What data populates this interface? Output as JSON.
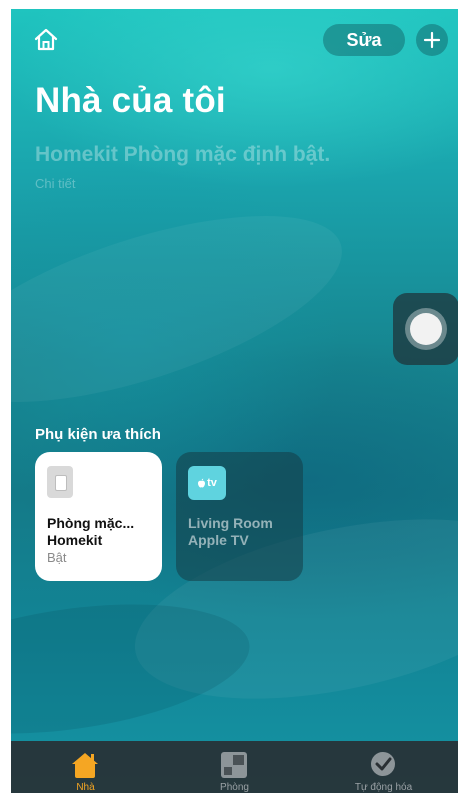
{
  "header": {
    "edit_label": "Sửa",
    "add_icon": "plus-icon",
    "home_icon": "house-outline-icon"
  },
  "home": {
    "title": "Nhà của tôi",
    "status_summary": "Homekit Phòng mặc định bật.",
    "details_link": "Chi tiết"
  },
  "favorites": {
    "section_title": "Phụ kiện ưa thích",
    "tiles": [
      {
        "name_line1": "Phòng mặc...",
        "name_line2": "Homekit",
        "status": "Bật",
        "icon": "light-switch-icon",
        "active": true
      },
      {
        "name_line1": "Living Room",
        "name_line2": "Apple TV",
        "status": "",
        "icon": "apple-tv-icon",
        "icon_text": "tv",
        "active": false
      }
    ]
  },
  "tabbar": {
    "tabs": [
      {
        "label": "Nhà",
        "icon": "house-icon",
        "active": true
      },
      {
        "label": "Phòng",
        "icon": "rooms-icon",
        "active": false
      },
      {
        "label": "Tự động hóa",
        "icon": "automation-clock-icon",
        "active": false
      }
    ]
  },
  "colors": {
    "accent": "#f5a623",
    "background_top": "#1fc4bf",
    "background_mid": "#147a88",
    "tile_on": "#ffffff",
    "tile_off": "#143c46",
    "tabbar": "#283034"
  }
}
